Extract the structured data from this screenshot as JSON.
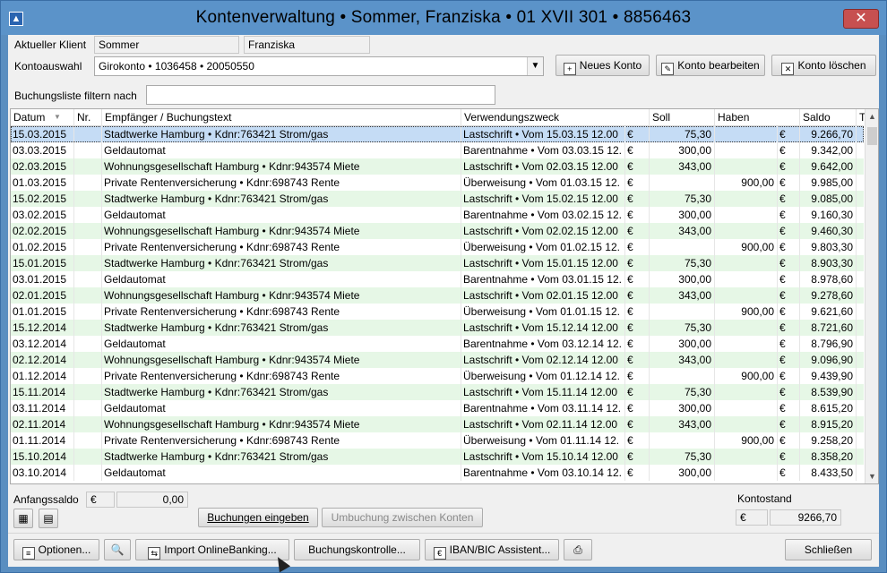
{
  "window": {
    "title": "Kontenverwaltung  •  Sommer, Franziska  •  01 XVII 301  •  8856463",
    "close_label": "✕"
  },
  "client": {
    "label": "Aktueller Klient",
    "lastname": "Sommer",
    "firstname": "Franziska"
  },
  "account": {
    "label": "Kontoauswahl",
    "selected": "Girokonto • 1036458 • 20050550",
    "new_label": "Neues Konto",
    "edit_label": "Konto bearbeiten",
    "delete_label": "Konto löschen"
  },
  "filter": {
    "label": "Buchungsliste filtern nach",
    "value": ""
  },
  "table": {
    "columns": [
      "Datum",
      "Nr.",
      "Empfänger / Buchungstext",
      "Verwendungszweck",
      "Soll",
      "Haben",
      "Saldo",
      "T"
    ],
    "rows": [
      {
        "date": "15.03.2015",
        "nr": "",
        "recipient": "Stadtwerke Hamburg • Kdnr:763421 Strom/gas",
        "purpose": "Lastschrift • Vom 15.03.15  12.00",
        "cur1": "€",
        "soll": "75,30",
        "haben": "",
        "cur2": "€",
        "saldo": "9.266,70"
      },
      {
        "date": "03.03.2015",
        "nr": "",
        "recipient": "Geldautomat",
        "purpose": "Barentnahme • Vom 03.03.15  12.",
        "cur1": "€",
        "soll": "300,00",
        "haben": "",
        "cur2": "€",
        "saldo": "9.342,00"
      },
      {
        "date": "02.03.2015",
        "nr": "",
        "recipient": "Wohnungsgesellschaft Hamburg • Kdnr:943574 Miete",
        "purpose": "Lastschrift • Vom 02.03.15  12.00",
        "cur1": "€",
        "soll": "343,00",
        "haben": "",
        "cur2": "€",
        "saldo": "9.642,00"
      },
      {
        "date": "01.03.2015",
        "nr": "",
        "recipient": "Private Rentenversicherung • Kdnr:698743 Rente",
        "purpose": "Überweisung • Vom 01.03.15  12.",
        "cur1": "€",
        "soll": "",
        "haben": "900,00",
        "cur2": "€",
        "saldo": "9.985,00"
      },
      {
        "date": "15.02.2015",
        "nr": "",
        "recipient": "Stadtwerke Hamburg • Kdnr:763421 Strom/gas",
        "purpose": "Lastschrift • Vom 15.02.15  12.00",
        "cur1": "€",
        "soll": "75,30",
        "haben": "",
        "cur2": "€",
        "saldo": "9.085,00"
      },
      {
        "date": "03.02.2015",
        "nr": "",
        "recipient": "Geldautomat",
        "purpose": "Barentnahme • Vom 03.02.15  12.",
        "cur1": "€",
        "soll": "300,00",
        "haben": "",
        "cur2": "€",
        "saldo": "9.160,30"
      },
      {
        "date": "02.02.2015",
        "nr": "",
        "recipient": "Wohnungsgesellschaft Hamburg • Kdnr:943574 Miete",
        "purpose": "Lastschrift • Vom 02.02.15  12.00",
        "cur1": "€",
        "soll": "343,00",
        "haben": "",
        "cur2": "€",
        "saldo": "9.460,30"
      },
      {
        "date": "01.02.2015",
        "nr": "",
        "recipient": "Private Rentenversicherung • Kdnr:698743 Rente",
        "purpose": "Überweisung • Vom 01.02.15  12.",
        "cur1": "€",
        "soll": "",
        "haben": "900,00",
        "cur2": "€",
        "saldo": "9.803,30"
      },
      {
        "date": "15.01.2015",
        "nr": "",
        "recipient": "Stadtwerke Hamburg • Kdnr:763421 Strom/gas",
        "purpose": "Lastschrift • Vom 15.01.15  12.00",
        "cur1": "€",
        "soll": "75,30",
        "haben": "",
        "cur2": "€",
        "saldo": "8.903,30"
      },
      {
        "date": "03.01.2015",
        "nr": "",
        "recipient": "Geldautomat",
        "purpose": "Barentnahme • Vom 03.01.15  12.",
        "cur1": "€",
        "soll": "300,00",
        "haben": "",
        "cur2": "€",
        "saldo": "8.978,60"
      },
      {
        "date": "02.01.2015",
        "nr": "",
        "recipient": "Wohnungsgesellschaft Hamburg • Kdnr:943574 Miete",
        "purpose": "Lastschrift • Vom 02.01.15  12.00",
        "cur1": "€",
        "soll": "343,00",
        "haben": "",
        "cur2": "€",
        "saldo": "9.278,60"
      },
      {
        "date": "01.01.2015",
        "nr": "",
        "recipient": "Private Rentenversicherung • Kdnr:698743 Rente",
        "purpose": "Überweisung • Vom 01.01.15  12.",
        "cur1": "€",
        "soll": "",
        "haben": "900,00",
        "cur2": "€",
        "saldo": "9.621,60"
      },
      {
        "date": "15.12.2014",
        "nr": "",
        "recipient": "Stadtwerke Hamburg • Kdnr:763421 Strom/gas",
        "purpose": "Lastschrift • Vom 15.12.14  12.00",
        "cur1": "€",
        "soll": "75,30",
        "haben": "",
        "cur2": "€",
        "saldo": "8.721,60"
      },
      {
        "date": "03.12.2014",
        "nr": "",
        "recipient": "Geldautomat",
        "purpose": "Barentnahme • Vom 03.12.14  12.",
        "cur1": "€",
        "soll": "300,00",
        "haben": "",
        "cur2": "€",
        "saldo": "8.796,90"
      },
      {
        "date": "02.12.2014",
        "nr": "",
        "recipient": "Wohnungsgesellschaft Hamburg • Kdnr:943574 Miete",
        "purpose": "Lastschrift • Vom 02.12.14  12.00",
        "cur1": "€",
        "soll": "343,00",
        "haben": "",
        "cur2": "€",
        "saldo": "9.096,90"
      },
      {
        "date": "01.12.2014",
        "nr": "",
        "recipient": "Private Rentenversicherung • Kdnr:698743 Rente",
        "purpose": "Überweisung • Vom 01.12.14  12.",
        "cur1": "€",
        "soll": "",
        "haben": "900,00",
        "cur2": "€",
        "saldo": "9.439,90"
      },
      {
        "date": "15.11.2014",
        "nr": "",
        "recipient": "Stadtwerke Hamburg • Kdnr:763421 Strom/gas",
        "purpose": "Lastschrift • Vom 15.11.14  12.00",
        "cur1": "€",
        "soll": "75,30",
        "haben": "",
        "cur2": "€",
        "saldo": "8.539,90"
      },
      {
        "date": "03.11.2014",
        "nr": "",
        "recipient": "Geldautomat",
        "purpose": "Barentnahme • Vom 03.11.14  12.",
        "cur1": "€",
        "soll": "300,00",
        "haben": "",
        "cur2": "€",
        "saldo": "8.615,20"
      },
      {
        "date": "02.11.2014",
        "nr": "",
        "recipient": "Wohnungsgesellschaft Hamburg • Kdnr:943574 Miete",
        "purpose": "Lastschrift • Vom 02.11.14  12.00",
        "cur1": "€",
        "soll": "343,00",
        "haben": "",
        "cur2": "€",
        "saldo": "8.915,20"
      },
      {
        "date": "01.11.2014",
        "nr": "",
        "recipient": "Private Rentenversicherung • Kdnr:698743 Rente",
        "purpose": "Überweisung • Vom 01.11.14  12.",
        "cur1": "€",
        "soll": "",
        "haben": "900,00",
        "cur2": "€",
        "saldo": "9.258,20"
      },
      {
        "date": "15.10.2014",
        "nr": "",
        "recipient": "Stadtwerke Hamburg • Kdnr:763421 Strom/gas",
        "purpose": "Lastschrift • Vom 15.10.14  12.00",
        "cur1": "€",
        "soll": "75,30",
        "haben": "",
        "cur2": "€",
        "saldo": "8.358,20"
      },
      {
        "date": "03.10.2014",
        "nr": "",
        "recipient": "Geldautomat",
        "purpose": "Barentnahme • Vom 03.10.14  12.",
        "cur1": "€",
        "soll": "300,00",
        "haben": "",
        "cur2": "€",
        "saldo": "8.433,50"
      }
    ]
  },
  "footer": {
    "opening_label": "Anfangssaldo",
    "opening_currency": "€",
    "opening_value": "0,00",
    "enter_bookings": "Buchungen eingeben",
    "transfer": "Umbuchung zwischen Konten",
    "balance_label": "Kontostand",
    "balance_currency": "€",
    "balance_value": "9266,70"
  },
  "bottom": {
    "options": "Optionen...",
    "import": "Import OnlineBanking...",
    "control": "Buchungskontrolle...",
    "iban": "IBAN/BIC Assistent...",
    "close": "Schließen"
  }
}
